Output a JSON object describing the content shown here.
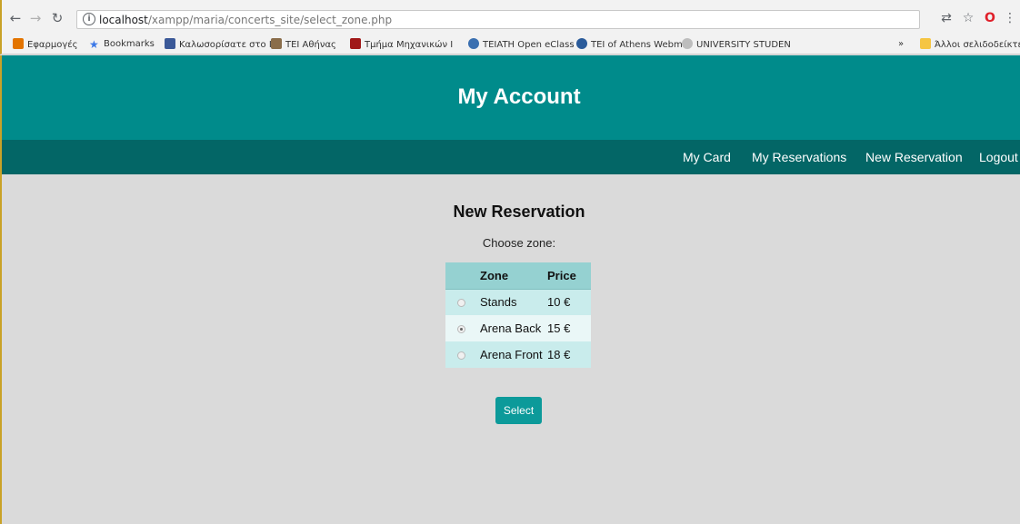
{
  "browser": {
    "url_host": "localhost",
    "url_path": "/xampp/maria/concerts_site/select_zone.php",
    "bookmarks": [
      {
        "label": "Εφαρμογές",
        "icon": "apps-grid-icon",
        "color": "#e37400"
      },
      {
        "label": "Bookmarks",
        "icon": "star-icon",
        "color": "#3b78e7"
      },
      {
        "label": "Καλωσορίσατε στο Ι",
        "icon": "facebook-icon",
        "color": "#3b5998"
      },
      {
        "label": "TEI Αθήνας",
        "icon": "tei-logo-icon",
        "color": "#8a6d4a"
      },
      {
        "label": "Τμήμα Μηχανικών Ι",
        "icon": "dept-logo-icon",
        "color": "#a01818"
      },
      {
        "label": "TEIATH Open eClass",
        "icon": "eclass-icon",
        "color": "#3a6fb0"
      },
      {
        "label": "TEI of Athens Webm",
        "icon": "webmail-icon",
        "color": "#2a5b9a"
      },
      {
        "label": "UNIVERSITY STUDEN",
        "icon": "university-seal-icon",
        "color": "#9a9a9a"
      }
    ],
    "overflow_label": "»",
    "other_bookmarks": "Άλλοι σελιδοδείκτες"
  },
  "site": {
    "title": "My Account",
    "nav": [
      "My Card",
      "My Reservations",
      "New Reservation",
      "Logout"
    ]
  },
  "content": {
    "title": "New Reservation",
    "subtitle": "Choose zone:",
    "table": {
      "headers": [
        "",
        "Zone",
        "Price"
      ],
      "rows": [
        {
          "zone": "Stands",
          "price": "10 €",
          "selected": false
        },
        {
          "zone": "Arena Back",
          "price": "15 €",
          "selected": true
        },
        {
          "zone": "Arena Front",
          "price": "18 €",
          "selected": false
        }
      ]
    },
    "button_label": "Select"
  },
  "colors": {
    "header": "#008b8b",
    "nav": "#036666",
    "button": "#0c9a9a"
  }
}
